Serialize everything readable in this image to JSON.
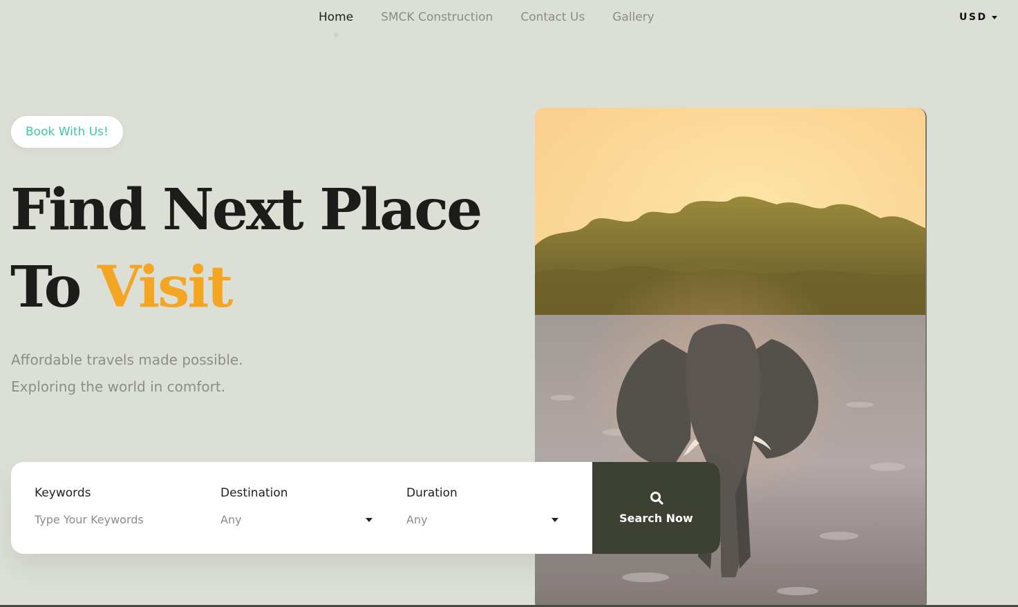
{
  "nav": {
    "items": [
      {
        "label": "Home",
        "active": true
      },
      {
        "label": "SMCK Construction",
        "active": false
      },
      {
        "label": "Contact Us",
        "active": false
      },
      {
        "label": "Gallery",
        "active": false
      }
    ],
    "currency": "USD"
  },
  "hero": {
    "badge": "Book With Us!",
    "headline_line1": "Find Next Place",
    "headline_line2_prefix": "To",
    "headline_line2_accent": "Visit",
    "subtitle_line1": "Affordable travels made possible.",
    "subtitle_line2": "Exploring the world in comfort."
  },
  "search": {
    "keywords_label": "Keywords",
    "keywords_placeholder": "Type Your Keywords",
    "destination_label": "Destination",
    "destination_value": "Any",
    "duration_label": "Duration",
    "duration_value": "Any",
    "button_label": "Search Now",
    "button_icon": "search-icon"
  },
  "colors": {
    "background": "#dcdfd6",
    "accent_orange": "#f4a521",
    "accent_teal": "#3cc9a6",
    "button_dark": "#3d4134"
  }
}
